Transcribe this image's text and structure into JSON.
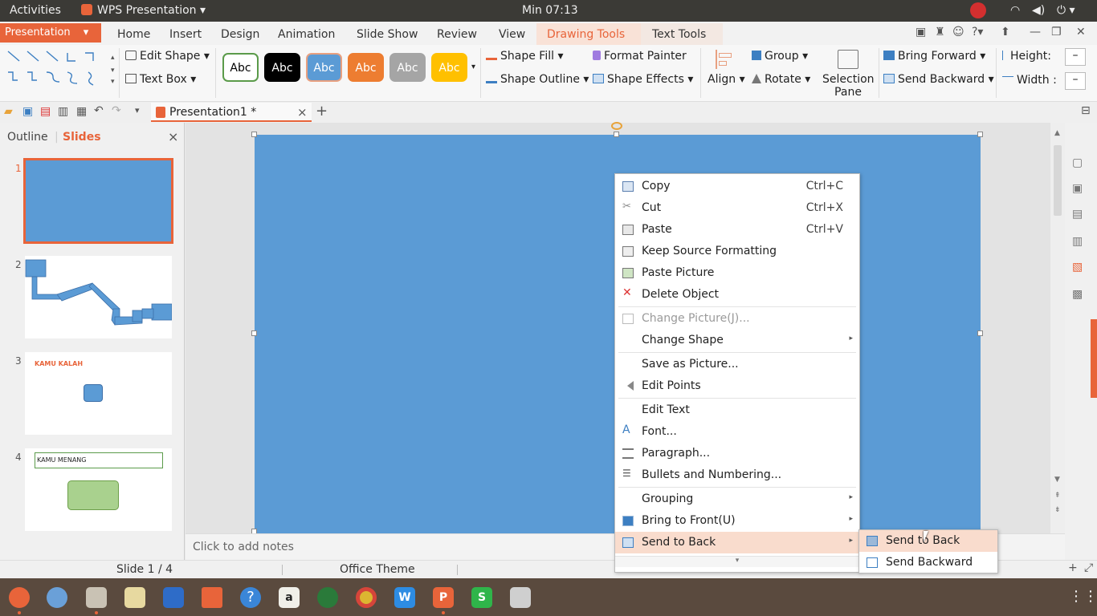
{
  "system": {
    "activities": "Activities",
    "app_name": "WPS Presentation",
    "clock": "Min 07:13"
  },
  "ribbon": {
    "app_button": "Presentation",
    "tabs": [
      "Home",
      "Insert",
      "Design",
      "Animation",
      "Slide Show",
      "Review",
      "View"
    ],
    "drawing_tools": "Drawing Tools",
    "text_tools": "Text Tools"
  },
  "toolbar": {
    "edit_shape": "Edit Shape",
    "text_box": "Text Box",
    "style_label": "Abc",
    "styles": [
      {
        "bg": "#ffffff",
        "fg": "#000000",
        "border": "#5b9b4a"
      },
      {
        "bg": "#000000",
        "fg": "#ffffff",
        "border": "#000000"
      },
      {
        "bg": "#5b9bd5",
        "fg": "#ffffff",
        "border": "#e8a080"
      },
      {
        "bg": "#ed7d31",
        "fg": "#ffffff",
        "border": "#ed7d31"
      },
      {
        "bg": "#a5a5a5",
        "fg": "#ffffff",
        "border": "#a5a5a5"
      },
      {
        "bg": "#ffc000",
        "fg": "#ffffff",
        "border": "#ffc000"
      }
    ],
    "shape_fill": "Shape Fill",
    "shape_outline": "Shape Outline",
    "format_painter": "Format Painter",
    "shape_effects": "Shape Effects",
    "align": "Align",
    "group": "Group",
    "rotate": "Rotate",
    "selection_pane_1": "Selection",
    "selection_pane_2": "Pane",
    "bring_forward": "Bring Forward",
    "send_backward": "Send Backward",
    "height": "Height:",
    "width": "Width :",
    "minus": "–"
  },
  "document": {
    "tab_title": "Presentation1 *",
    "close": "×",
    "new_tab": "+"
  },
  "left_panel": {
    "outline": "Outline",
    "slides": "Slides",
    "close": "×",
    "thumbnails": [
      {
        "num": "1",
        "text": ""
      },
      {
        "num": "2",
        "text": ""
      },
      {
        "num": "3",
        "text": "KAMU KALAH"
      },
      {
        "num": "4",
        "text": "KAMU MENANG"
      }
    ]
  },
  "notes": {
    "placeholder": "Click to add notes"
  },
  "status": {
    "slide": "Slide 1 / 4",
    "theme": "Office Theme"
  },
  "context_menu": {
    "items": [
      {
        "label": "Copy",
        "shortcut": "Ctrl+C"
      },
      {
        "label": "Cut",
        "shortcut": "Ctrl+X"
      },
      {
        "label": "Paste",
        "shortcut": "Ctrl+V"
      },
      {
        "label": "Keep Source Formatting",
        "shortcut": ""
      },
      {
        "label": "Paste Picture",
        "shortcut": ""
      },
      {
        "label": "Delete Object",
        "shortcut": ""
      },
      {
        "label": "Change Picture(J)...",
        "shortcut": ""
      },
      {
        "label": "Change Shape",
        "shortcut": ""
      },
      {
        "label": "Save as Picture...",
        "shortcut": ""
      },
      {
        "label": "Edit Points",
        "shortcut": ""
      },
      {
        "label": "Edit Text",
        "shortcut": ""
      },
      {
        "label": "Font...",
        "shortcut": ""
      },
      {
        "label": "Paragraph...",
        "shortcut": ""
      },
      {
        "label": "Bullets and Numbering...",
        "shortcut": ""
      },
      {
        "label": "Grouping",
        "shortcut": ""
      },
      {
        "label": "Bring to Front(U)",
        "shortcut": ""
      },
      {
        "label": "Send to Back",
        "shortcut": ""
      }
    ]
  },
  "submenu": {
    "items": [
      {
        "label": "Send to Back"
      },
      {
        "label": "Send Backward"
      }
    ]
  },
  "colors": {
    "accent": "#e8643a",
    "slide_bg": "#5b9bd5",
    "menu_highlight": "#f9dccd"
  }
}
